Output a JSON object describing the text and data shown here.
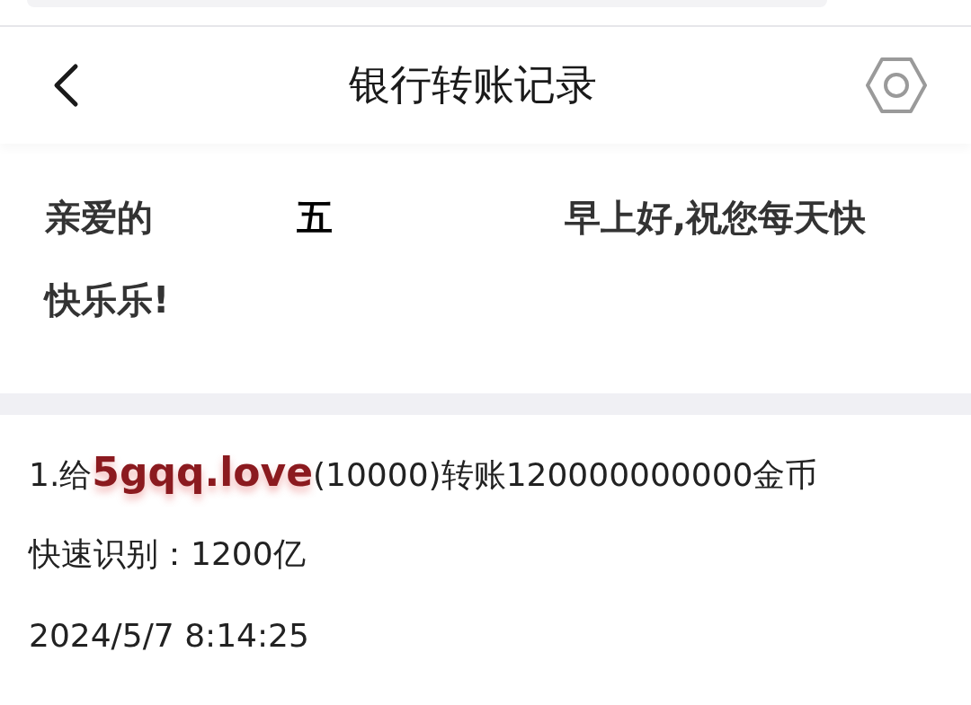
{
  "header": {
    "title": "银行转账记录"
  },
  "greeting": {
    "parts": [
      {
        "text": "亲爱的",
        "emphasis": false
      },
      {
        "text": "五",
        "emphasis": true
      },
      {
        "text": "早上好,祝您每天快",
        "emphasis": false
      }
    ],
    "line_2": "快乐乐!"
  },
  "records": [
    {
      "description": "1.给**5gqq.love**(10000)转账120000000000金币",
      "quick_read": "快速识别：1200亿",
      "time": "2024/5/7 8:14:25"
    }
  ]
}
